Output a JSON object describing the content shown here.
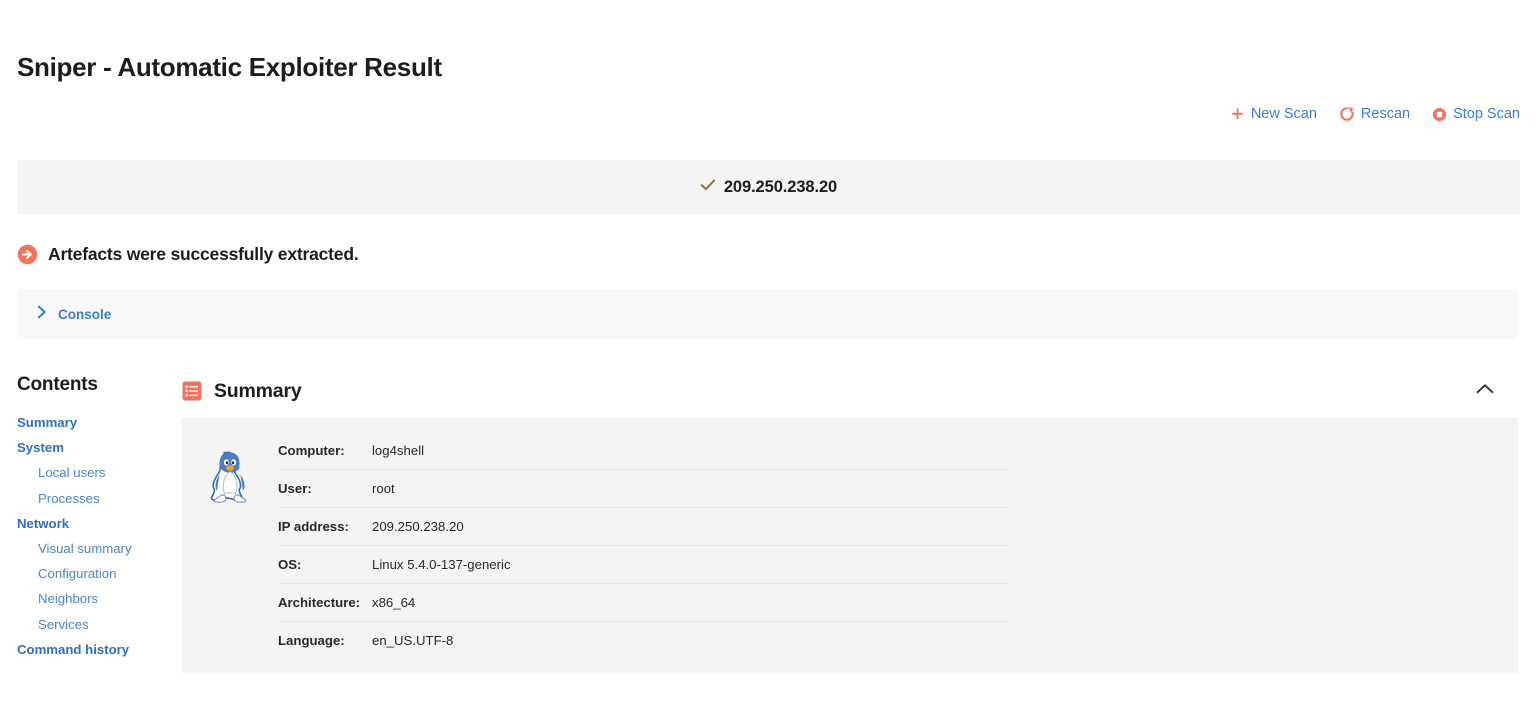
{
  "page": {
    "title": "Sniper - Automatic Exploiter Result"
  },
  "actions": [
    {
      "id": "new-scan",
      "label": "New Scan",
      "icon": "plus-icon",
      "icon_color": "#f4735c"
    },
    {
      "id": "rescan",
      "label": "Rescan",
      "icon": "refresh-icon",
      "icon_color": "#f4735c"
    },
    {
      "id": "stop-scan",
      "label": "Stop Scan",
      "icon": "stop-circle-icon",
      "icon_color": "#f4735c"
    }
  ],
  "target_banner": {
    "icon": "check-icon",
    "icon_color": "#9a7b3f",
    "ip": "209.250.238.20",
    "background": "#f4f4f5"
  },
  "artefacts": {
    "icon": "arrow-right-circle-icon",
    "icon_color": "#f4735c",
    "message": "Artefacts were successfully extracted."
  },
  "console": {
    "icon": "chevron-right-icon",
    "label": "Console",
    "color": "#3b7ddd"
  },
  "contents": {
    "title": "Contents",
    "items": [
      {
        "label": "Summary",
        "level": 0
      },
      {
        "label": "System",
        "level": 0
      },
      {
        "label": "Local users",
        "level": 1
      },
      {
        "label": "Processes",
        "level": 1
      },
      {
        "label": "Network",
        "level": 0
      },
      {
        "label": "Visual summary",
        "level": 1
      },
      {
        "label": "Configuration",
        "level": 1
      },
      {
        "label": "Neighbors",
        "level": 1
      },
      {
        "label": "Services",
        "level": 1
      },
      {
        "label": "Command history",
        "level": 0
      }
    ]
  },
  "summary": {
    "icon": "list-icon",
    "icon_color": "#f4735c",
    "title": "Summary",
    "collapse_icon": "chevron-up-icon",
    "os_logo": "linux-tux-icon",
    "rows": [
      {
        "key": "Computer:",
        "value": "log4shell"
      },
      {
        "key": "User:",
        "value": "root"
      },
      {
        "key": "IP address:",
        "value": "209.250.238.20"
      },
      {
        "key": "OS:",
        "value": "Linux 5.4.0-137-generic"
      },
      {
        "key": "Architecture:",
        "value": "x86_64"
      },
      {
        "key": "Language:",
        "value": "en_US.UTF-8"
      }
    ]
  },
  "theme": {
    "accent": "#f4735c",
    "link": "#3b7ddd",
    "panel_bg": "#f4f4f5",
    "panel_bg_light": "#f9f9fa"
  }
}
